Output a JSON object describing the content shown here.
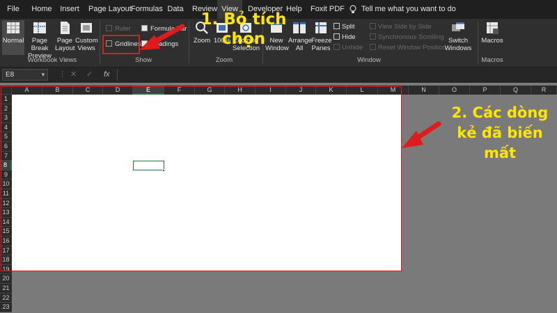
{
  "tabs": [
    {
      "label": "File"
    },
    {
      "label": "Home"
    },
    {
      "label": "Insert"
    },
    {
      "label": "Page Layout"
    },
    {
      "label": "Formulas"
    },
    {
      "label": "Data"
    },
    {
      "label": "Review"
    },
    {
      "label": "View"
    },
    {
      "label": "Developer"
    },
    {
      "label": "Help"
    },
    {
      "label": "Foxit PDF"
    }
  ],
  "tell_me": "Tell me what you want to do",
  "ribbon": {
    "workbook_views": {
      "label": "Workbook Views",
      "normal": "Normal",
      "page_break": "Page Break Preview",
      "page_layout": "Page Layout",
      "custom_views": "Custom Views"
    },
    "show": {
      "label": "Show",
      "ruler": "Ruler",
      "formula_bar": "Formula Bar",
      "gridlines": "Gridlines",
      "headings": "Headings"
    },
    "zoom": {
      "label": "Zoom",
      "zoom": "Zoom",
      "hundred": "100%",
      "zoom_to_selection": "Zoom to Selection"
    },
    "window": {
      "label": "Window",
      "new_window": "New Window",
      "arrange_all": "Arrange All",
      "freeze_panes": "Freeze Panes",
      "split": "Split",
      "hide": "Hide",
      "unhide": "Unhide",
      "view_side_by_side": "View Side by Side",
      "synchronous_scrolling": "Synchronous Scrolling",
      "reset_window_position": "Reset Window Position",
      "switch_windows": "Switch Windows"
    },
    "macros": {
      "label": "Macros",
      "macros": "Macros"
    }
  },
  "formula_bar": {
    "name_box": "E8",
    "cancel_icon": "cancel-icon",
    "enter_icon": "check-icon",
    "fx": "fx"
  },
  "sheet": {
    "columns": [
      "A",
      "B",
      "C",
      "D",
      "E",
      "F",
      "G",
      "H",
      "I",
      "J",
      "K",
      "L",
      "M",
      "N",
      "O",
      "P",
      "Q",
      "R"
    ],
    "rows": [
      "1",
      "2",
      "3",
      "4",
      "5",
      "6",
      "7",
      "8",
      "9",
      "10",
      "11",
      "12",
      "13",
      "14",
      "15",
      "16",
      "17",
      "18",
      "19",
      "20",
      "21",
      "22",
      "23"
    ],
    "active_cell": "E8"
  },
  "annotations": {
    "step1_line1": "1. Bỏ tích",
    "step1_line2": "chọn",
    "step2_line1": "2. Các dòng",
    "step2_line2": "kẻ đã biến",
    "step2_line3": "mất"
  },
  "colors": {
    "accent": "#217346",
    "annotation_text": "#ffe600",
    "annotation_frame": "#e01b1b"
  }
}
